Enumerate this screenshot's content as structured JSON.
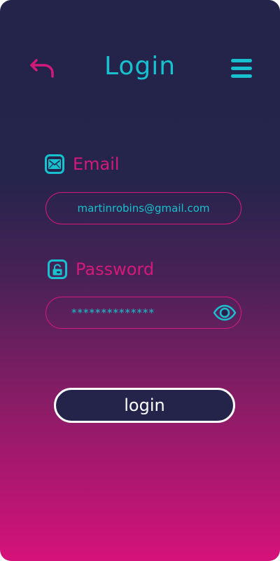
{
  "header": {
    "title": "Login",
    "back_icon": "back-arrow-icon",
    "menu_icon": "hamburger-menu-icon"
  },
  "email": {
    "label": "Email",
    "icon": "envelope-icon",
    "value": "martinrobins@gmail.com"
  },
  "password": {
    "label": "Password",
    "icon": "lock-icon",
    "value": "**************",
    "toggle_icon": "eye-icon"
  },
  "login_button": {
    "label": "login"
  },
  "colors": {
    "accent_cyan": "#17c1cf",
    "accent_pink": "#d41a79",
    "background_top": "#24244a",
    "background_bottom": "#d5127a"
  }
}
